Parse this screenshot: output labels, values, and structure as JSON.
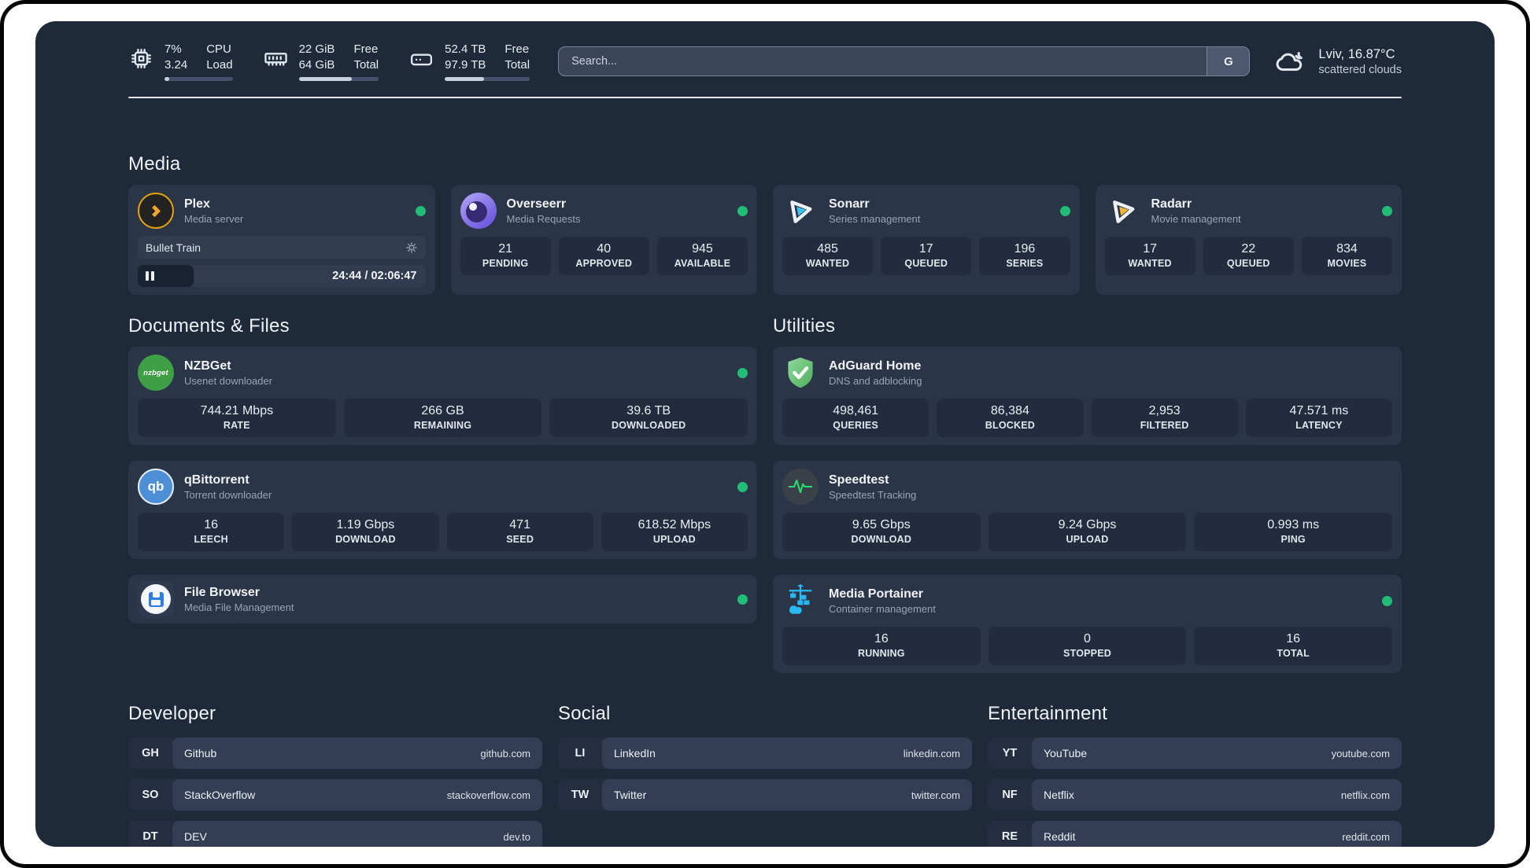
{
  "header": {
    "system_stats": [
      {
        "icon": "cpu-icon",
        "line1_value": "7%",
        "line2_value": "3.24",
        "line1_label": "CPU",
        "line2_label": "Load",
        "progress_pct": 7
      },
      {
        "icon": "memory-icon",
        "line1_value": "22 GiB",
        "line2_value": "64 GiB",
        "line1_label": "Free",
        "line2_label": "Total",
        "progress_pct": 66
      },
      {
        "icon": "storage-icon",
        "line1_value": "52.4 TB",
        "line2_value": "97.9 TB",
        "line1_label": "Free",
        "line2_label": "Total",
        "progress_pct": 46
      }
    ],
    "search": {
      "placeholder": "Search...",
      "engine_button_label": "G"
    },
    "weather": {
      "icon": "cloud-icon",
      "summary": "Lviv, 16.87°C",
      "description": "scattered clouds"
    }
  },
  "media": {
    "title": "Media",
    "plex": {
      "name": "Plex",
      "description": "Media server",
      "online": true,
      "now_playing": {
        "title": "Bullet Train",
        "time_display": "24:44 / 02:06:47",
        "progress_pct": 19.5
      }
    },
    "apps": [
      {
        "name": "Overseerr",
        "description": "Media Requests",
        "online": true,
        "stats": [
          {
            "value": "21",
            "label": "PENDING"
          },
          {
            "value": "40",
            "label": "APPROVED"
          },
          {
            "value": "945",
            "label": "AVAILABLE"
          }
        ]
      },
      {
        "name": "Sonarr",
        "description": "Series management",
        "online": true,
        "stats": [
          {
            "value": "485",
            "label": "WANTED"
          },
          {
            "value": "17",
            "label": "QUEUED"
          },
          {
            "value": "196",
            "label": "SERIES"
          }
        ]
      },
      {
        "name": "Radarr",
        "description": "Movie management",
        "online": true,
        "stats": [
          {
            "value": "17",
            "label": "WANTED"
          },
          {
            "value": "22",
            "label": "QUEUED"
          },
          {
            "value": "834",
            "label": "MOVIES"
          }
        ]
      }
    ]
  },
  "documents": {
    "title": "Documents & Files",
    "apps": [
      {
        "name": "NZBGet",
        "description": "Usenet downloader",
        "online": true,
        "stats": [
          {
            "value": "744.21 Mbps",
            "label": "RATE"
          },
          {
            "value": "266 GB",
            "label": "REMAINING"
          },
          {
            "value": "39.6 TB",
            "label": "DOWNLOADED"
          }
        ]
      },
      {
        "name": "qBittorrent",
        "description": "Torrent downloader",
        "online": true,
        "stats": [
          {
            "value": "16",
            "label": "LEECH"
          },
          {
            "value": "1.19 Gbps",
            "label": "DOWNLOAD"
          },
          {
            "value": "471",
            "label": "SEED"
          },
          {
            "value": "618.52 Mbps",
            "label": "UPLOAD"
          }
        ]
      },
      {
        "name": "File Browser",
        "description": "Media File Management",
        "online": true,
        "stats": []
      }
    ]
  },
  "utilities": {
    "title": "Utilities",
    "apps": [
      {
        "name": "AdGuard Home",
        "description": "DNS and adblocking",
        "online": false,
        "stats": [
          {
            "value": "498,461",
            "label": "QUERIES"
          },
          {
            "value": "86,384",
            "label": "BLOCKED"
          },
          {
            "value": "2,953",
            "label": "FILTERED"
          },
          {
            "value": "47.571 ms",
            "label": "LATENCY"
          }
        ]
      },
      {
        "name": "Speedtest",
        "description": "Speedtest Tracking",
        "online": false,
        "stats": [
          {
            "value": "9.65 Gbps",
            "label": "DOWNLOAD"
          },
          {
            "value": "9.24 Gbps",
            "label": "UPLOAD"
          },
          {
            "value": "0.993 ms",
            "label": "PING"
          }
        ]
      },
      {
        "name": "Media Portainer",
        "description": "Container management",
        "online": true,
        "stats": [
          {
            "value": "16",
            "label": "RUNNING"
          },
          {
            "value": "0",
            "label": "STOPPED"
          },
          {
            "value": "16",
            "label": "TOTAL"
          }
        ]
      }
    ]
  },
  "links": {
    "developer": {
      "title": "Developer",
      "items": [
        {
          "abbr": "GH",
          "name": "Github",
          "url": "github.com"
        },
        {
          "abbr": "SO",
          "name": "StackOverflow",
          "url": "stackoverflow.com"
        },
        {
          "abbr": "DT",
          "name": "DEV",
          "url": "dev.to"
        }
      ]
    },
    "social": {
      "title": "Social",
      "items": [
        {
          "abbr": "LI",
          "name": "LinkedIn",
          "url": "linkedin.com"
        },
        {
          "abbr": "TW",
          "name": "Twitter",
          "url": "twitter.com"
        }
      ]
    },
    "entertainment": {
      "title": "Entertainment",
      "items": [
        {
          "abbr": "YT",
          "name": "YouTube",
          "url": "youtube.com"
        },
        {
          "abbr": "NF",
          "name": "Netflix",
          "url": "netflix.com"
        },
        {
          "abbr": "RE",
          "name": "Reddit",
          "url": "reddit.com"
        }
      ]
    }
  },
  "colors": {
    "page_bg": "#1e2939",
    "card_bg": "#2a3547",
    "stat_bg": "#222c3e",
    "status_online": "#21bd77",
    "plex_accent": "#e5a00d",
    "sonarr_accent": "#38c6f4",
    "radarr_accent": "#f8b63a",
    "portainer_accent": "#2ab6ef",
    "adguard_accent": "#57b464",
    "speedtest_accent": "#27e06e"
  }
}
